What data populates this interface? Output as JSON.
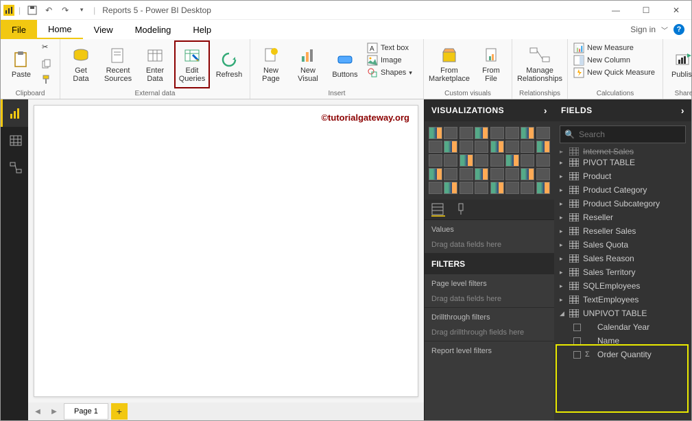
{
  "title": "Reports 5 - Power BI Desktop",
  "signin": "Sign in",
  "menu": {
    "file": "File",
    "home": "Home",
    "view": "View",
    "modeling": "Modeling",
    "help": "Help"
  },
  "ribbon": {
    "clipboard": {
      "paste": "Paste",
      "label": "Clipboard"
    },
    "external": {
      "getdata": "Get\nData",
      "recent": "Recent\nSources",
      "enter": "Enter\nData",
      "edit": "Edit\nQueries",
      "refresh": "Refresh",
      "label": "External data"
    },
    "insert": {
      "newpage": "New\nPage",
      "newvisual": "New\nVisual",
      "buttons": "Buttons",
      "textbox": "Text box",
      "image": "Image",
      "shapes": "Shapes",
      "label": "Insert"
    },
    "custom": {
      "marketplace": "From\nMarketplace",
      "file": "From\nFile",
      "label": "Custom visuals"
    },
    "relationships": {
      "manage": "Manage\nRelationships",
      "label": "Relationships"
    },
    "calc": {
      "measure": "New Measure",
      "column": "New Column",
      "quick": "New Quick Measure",
      "label": "Calculations"
    },
    "share": {
      "publish": "Publish",
      "label": "Share"
    }
  },
  "watermark": "©tutorialgateway.org",
  "page_tab": "Page 1",
  "viz_header": "VISUALIZATIONS",
  "fields_header": "FIELDS",
  "search_placeholder": "Search",
  "values_label": "Values",
  "values_drop": "Drag data fields here",
  "filters_header": "FILTERS",
  "filters": {
    "page": "Page level filters",
    "page_drop": "Drag data fields here",
    "drill": "Drillthrough filters",
    "drill_drop": "Drag drillthrough fields here",
    "report": "Report level filters"
  },
  "fields_list": [
    {
      "name": "Internet Sales",
      "type": "table",
      "cutoff": true
    },
    {
      "name": "PIVOT TABLE",
      "type": "table"
    },
    {
      "name": "Product",
      "type": "table"
    },
    {
      "name": "Product Category",
      "type": "table"
    },
    {
      "name": "Product Subcategory",
      "type": "table"
    },
    {
      "name": "Reseller",
      "type": "table"
    },
    {
      "name": "Reseller Sales",
      "type": "table"
    },
    {
      "name": "Sales Quota",
      "type": "table"
    },
    {
      "name": "Sales Reason",
      "type": "table"
    },
    {
      "name": "Sales Territory",
      "type": "table"
    },
    {
      "name": "SQLEmployees",
      "type": "table"
    },
    {
      "name": "TextEmployees",
      "type": "table"
    },
    {
      "name": "UNPIVOT TABLE",
      "type": "table",
      "expanded": true,
      "columns": [
        {
          "name": "Calendar Year",
          "agg": false
        },
        {
          "name": "Name",
          "agg": false
        },
        {
          "name": "Order Quantity",
          "agg": true
        }
      ]
    }
  ]
}
